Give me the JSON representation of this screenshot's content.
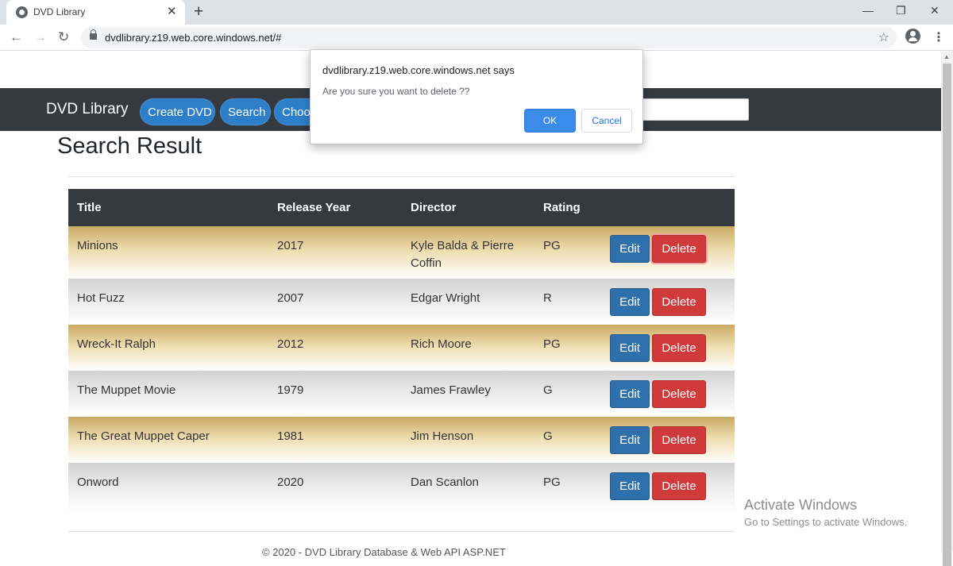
{
  "browser": {
    "tab_title": "DVD Library",
    "tab_close": "✕",
    "new_tab": "+",
    "url": "dvdlibrary.z19.web.core.windows.net/#",
    "back": "←",
    "forward": "→",
    "reload": "↻",
    "star": "☆",
    "menu": "⋮",
    "minimize": "—",
    "restore": "❐",
    "close": "✕"
  },
  "navbar": {
    "brand": "DVD Library",
    "items": [
      {
        "label": "Create DVD"
      },
      {
        "label": "Search"
      },
      {
        "label": "Choo"
      }
    ]
  },
  "page": {
    "title": "Search Result"
  },
  "table": {
    "headers": [
      "Title",
      "Release Year",
      "Director",
      "Rating"
    ],
    "edit_label": "Edit",
    "delete_label": "Delete",
    "rows": [
      {
        "title": "Minions",
        "year": "2017",
        "director": "Kyle Balda & Pierre Coffin",
        "rating": "PG"
      },
      {
        "title": "Hot Fuzz",
        "year": "2007",
        "director": "Edgar Wright",
        "rating": "R"
      },
      {
        "title": "Wreck-It Ralph",
        "year": "2012",
        "director": "Rich Moore",
        "rating": "PG"
      },
      {
        "title": "The Muppet Movie",
        "year": "1979",
        "director": "James Frawley",
        "rating": "G"
      },
      {
        "title": "The Great Muppet Caper",
        "year": "1981",
        "director": "Jim Henson",
        "rating": "G"
      },
      {
        "title": "Onword",
        "year": "2020",
        "director": "Dan Scanlon",
        "rating": "PG"
      }
    ]
  },
  "footer": {
    "text": "© 2020 - DVD Library Database & Web API ASP.NET"
  },
  "dialog": {
    "title": "dvdlibrary.z19.web.core.windows.net says",
    "message": "Are you sure you want to delete ??",
    "ok": "OK",
    "cancel": "Cancel"
  },
  "watermark": {
    "line1": "Activate Windows",
    "line2": "Go to Settings to activate Windows."
  },
  "colors": {
    "navbar_bg": "#343a40",
    "pill_blue": "#2e7fca",
    "edit_blue": "#2f6fab",
    "delete_red": "#d13a3a",
    "row_gold": "#c9aa63",
    "row_grey": "#d2d2d2",
    "dialog_ok": "#3b8beb"
  }
}
